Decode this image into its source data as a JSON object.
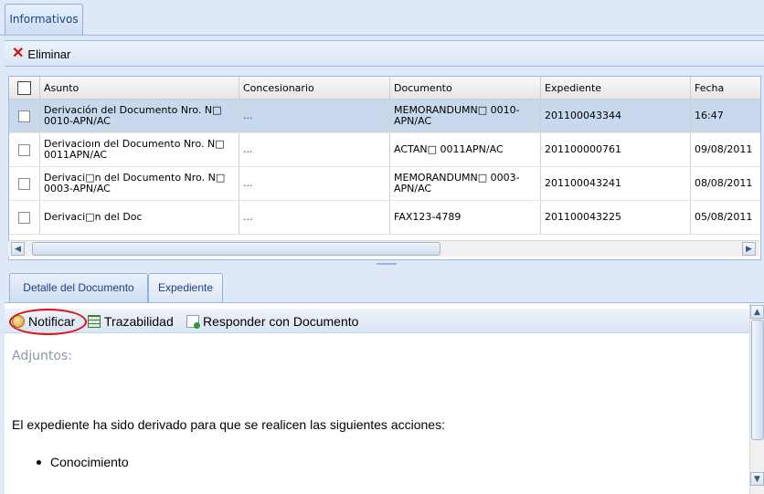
{
  "top_tab": {
    "label": "Informativos"
  },
  "toolbar": {
    "delete_label": "Eliminar"
  },
  "grid": {
    "columns": [
      "Asunto",
      "Concesionario",
      "Documento",
      "Expediente",
      "Fecha"
    ],
    "rows": [
      {
        "asunto": "Derivación del Documento Nro. N□ 0010-APN/AC",
        "concesionario": "...",
        "documento": "MEMORANDUMN□ 0010-APN/AC",
        "expediente": "201100043344",
        "fecha": "16:47"
      },
      {
        "asunto": "Derivacioın del Documento Nro. N□ 0011APN/AC",
        "concesionario": "...",
        "documento": "ACTAN□ 0011APN/AC",
        "expediente": "201100000761",
        "fecha": "09/08/2011"
      },
      {
        "asunto": "Derivaci□n del Documento Nro. N□ 0003-APN/AC",
        "concesionario": "...",
        "documento": "MEMORANDUMN□ 0003-APN/AC",
        "expediente": "201100043241",
        "fecha": "08/08/2011"
      },
      {
        "asunto": "Derivaci□n del Doc",
        "concesionario": "...",
        "documento": "FAX123-4789",
        "expediente": "201100043225",
        "fecha": "05/08/2011"
      }
    ]
  },
  "detail_tabs": [
    "Detalle del Documento",
    "Expediente"
  ],
  "detail_toolbar": {
    "notificar": "Notificar",
    "trazabilidad": "Trazabilidad",
    "responder": "Responder con Documento"
  },
  "detail": {
    "adjuntos_label": "Adjuntos:",
    "message": "El expediente ha sido derivado para que se realicen las siguientes acciones:",
    "actions": [
      "Conocimiento"
    ]
  }
}
